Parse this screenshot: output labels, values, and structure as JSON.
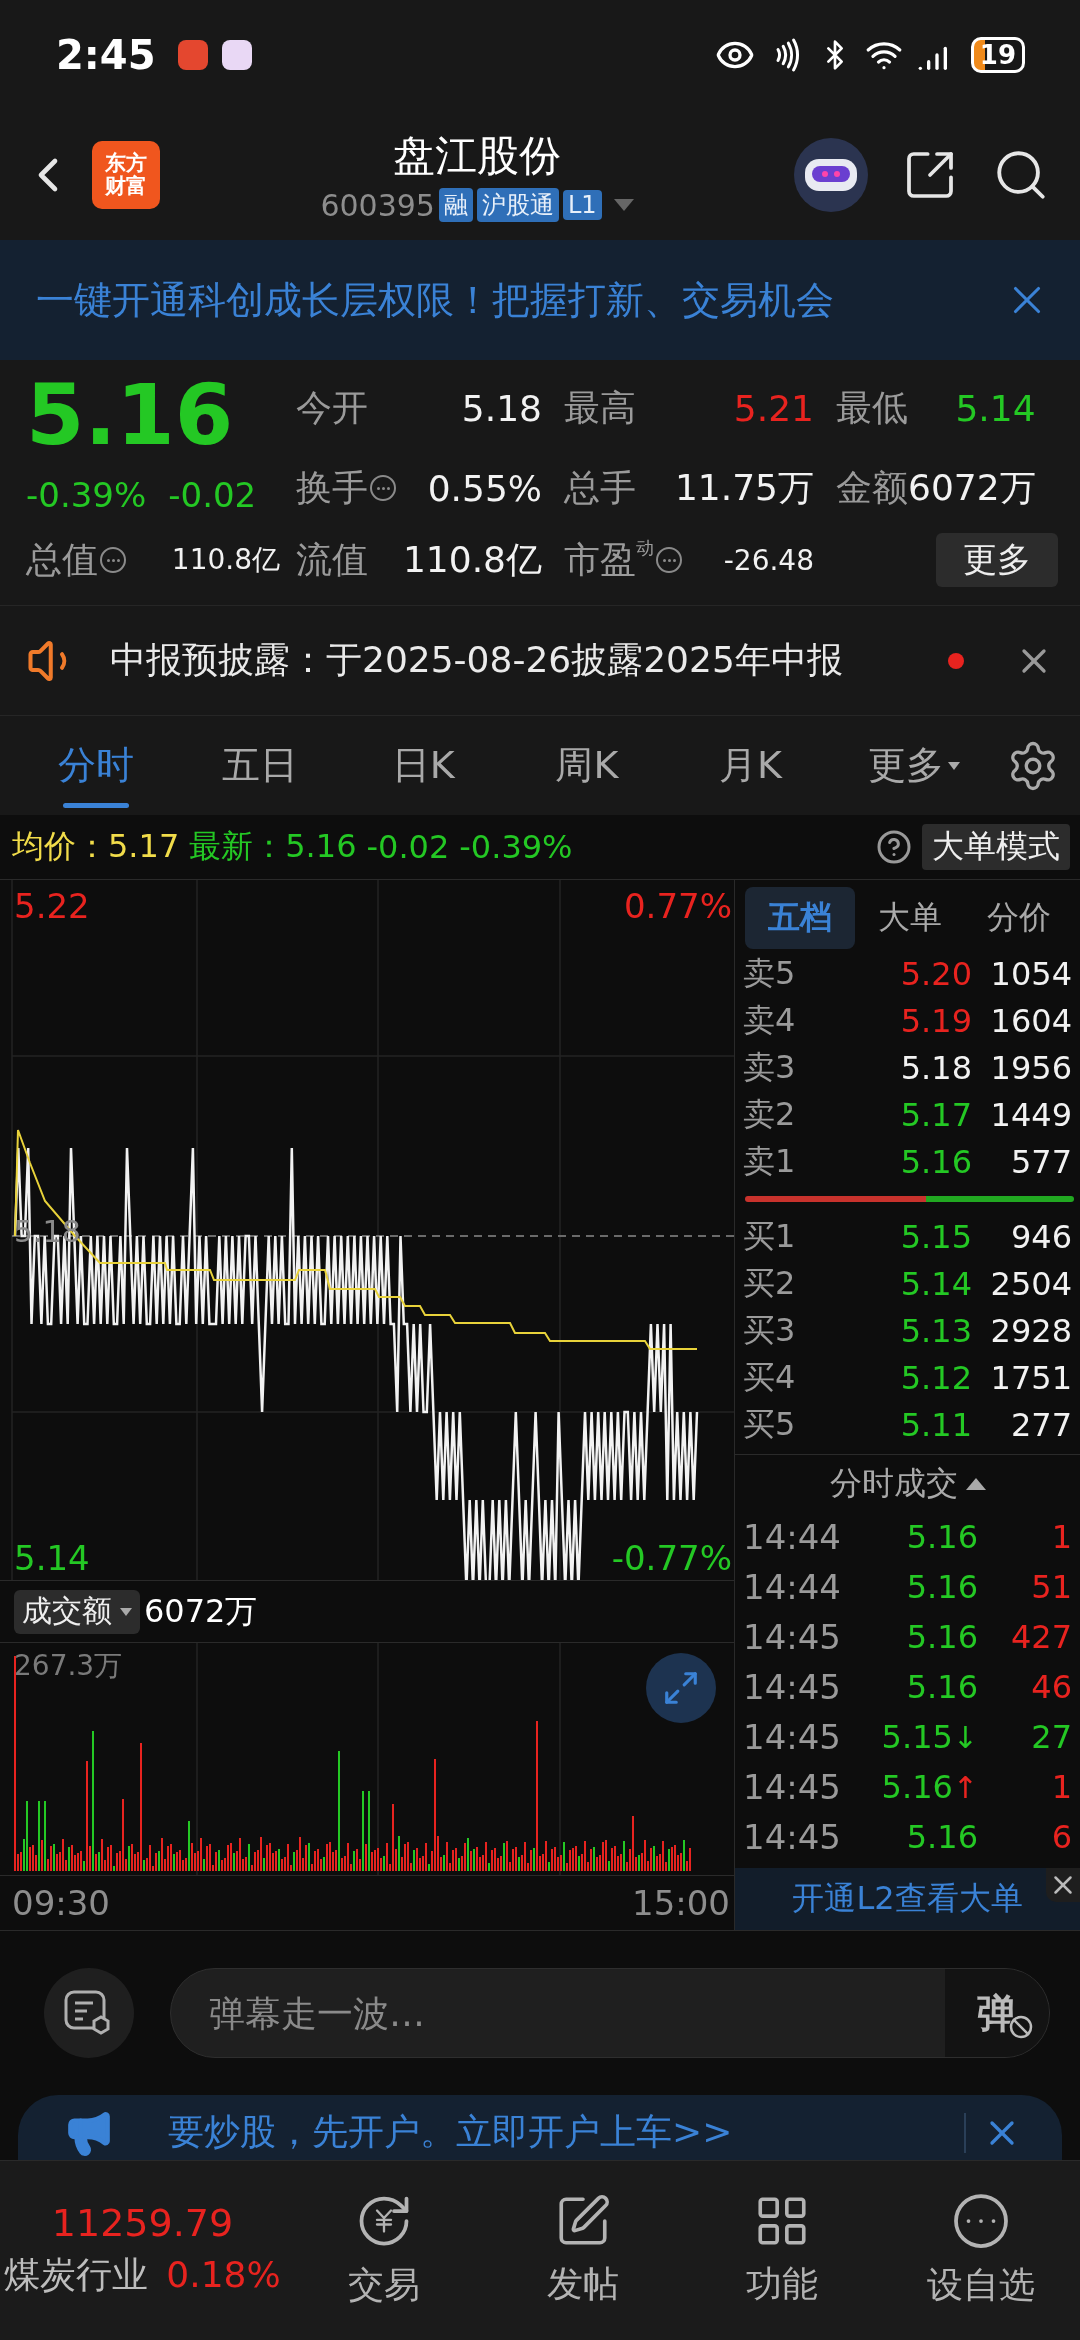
{
  "status_bar": {
    "time": "2:45",
    "battery": "19"
  },
  "header": {
    "logo": [
      "东方",
      "财富"
    ],
    "title": "盘江股份",
    "code": "600395",
    "badges": [
      "融",
      "沪股通",
      "L1"
    ]
  },
  "promo_banner": {
    "text": "一键开通科创成长层权限！把握打新、交易机会"
  },
  "quote": {
    "price": "5.16",
    "change_pct": "-0.39%",
    "change": "-0.02",
    "color": "#24c824",
    "stats": [
      {
        "label": "今开",
        "value": "5.18",
        "color": "#f2f2f2",
        "info": false,
        "kind": "normal"
      },
      {
        "label": "最高",
        "value": "5.21",
        "color": "#e8231f",
        "info": false,
        "kind": "normal"
      },
      {
        "label": "最低",
        "value": "5.14",
        "color": "#24c824",
        "info": false,
        "kind": "normal"
      },
      {
        "label": "换手",
        "value": "0.55%",
        "color": "#f2f2f2",
        "info": true,
        "kind": "normal"
      },
      {
        "label": "总手",
        "value": "11.75万",
        "color": "#f2f2f2",
        "info": false,
        "kind": "normal"
      },
      {
        "label": "金额",
        "value": "6072万",
        "color": "#f2f2f2",
        "info": false,
        "kind": "normal"
      },
      {
        "label": "流值",
        "value": "110.8亿",
        "color": "#f2f2f2",
        "info": false,
        "kind": "normal"
      },
      {
        "label": "市盈$^{动}$",
        "value": "-26.48",
        "color": "#f2f2f2",
        "info": true,
        "kind": "small"
      }
    ],
    "market_cap": {
      "label": "总值",
      "value": "110.8亿",
      "info": true
    },
    "more_button": "更多"
  },
  "notice": {
    "text": "中报预披露：于2025-08-26披露2025年中报",
    "unread": true
  },
  "chart_tabs": [
    {
      "label": "分时",
      "selected": true,
      "kind": "tab"
    },
    {
      "label": "五日",
      "selected": false,
      "kind": "tab"
    },
    {
      "label": "日K",
      "selected": false,
      "kind": "tab"
    },
    {
      "label": "周K",
      "selected": false,
      "kind": "tab"
    },
    {
      "label": "月K",
      "selected": false,
      "kind": "tab"
    },
    {
      "label": "更多",
      "selected": false,
      "kind": "menu"
    }
  ],
  "summary": {
    "avg_label": "均价：",
    "avg": "5.17",
    "latest_label": "最新：",
    "latest": "5.16",
    "change": "-0.02",
    "change_pct": "-0.39%",
    "mode_button": "大单模式"
  },
  "price_chart": {
    "high": "5.22",
    "high_pct": "0.77%",
    "prev_close": "5.18",
    "low": "5.14",
    "low_pct": "-0.77%"
  },
  "volume_chart": {
    "metric": "成交额",
    "total": "6072万",
    "max": "267.3万",
    "start": "09:30",
    "end": "15:00"
  },
  "order_book": {
    "tabs": [
      {
        "label": "五档",
        "selected": true
      },
      {
        "label": "大单",
        "selected": false
      },
      {
        "label": "分价",
        "selected": false
      }
    ],
    "asks": [
      {
        "label": "卖5",
        "price": "5.20",
        "volume": "1054",
        "color": "#e8231f"
      },
      {
        "label": "卖4",
        "price": "5.19",
        "volume": "1604",
        "color": "#e8231f"
      },
      {
        "label": "卖3",
        "price": "5.18",
        "volume": "1956",
        "color": "#f2f2f2"
      },
      {
        "label": "卖2",
        "price": "5.17",
        "volume": "1449",
        "color": "#24c824"
      },
      {
        "label": "卖1",
        "price": "5.16",
        "volume": "577",
        "color": "#24c824"
      }
    ],
    "bids": [
      {
        "label": "买1",
        "price": "5.15",
        "volume": "946",
        "color": "#24c824"
      },
      {
        "label": "买2",
        "price": "5.14",
        "volume": "2504",
        "color": "#24c824"
      },
      {
        "label": "买3",
        "price": "5.13",
        "volume": "2928",
        "color": "#24c824"
      },
      {
        "label": "买4",
        "price": "5.12",
        "volume": "1751",
        "color": "#24c824"
      },
      {
        "label": "买5",
        "price": "5.11",
        "volume": "277",
        "color": "#24c824"
      }
    ]
  },
  "trades": {
    "title": "分时成交",
    "rows": [
      {
        "time": "14:44",
        "price": "5.16",
        "volume": "1",
        "color": "#e8231f"
      },
      {
        "time": "14:44",
        "price": "5.16",
        "volume": "51",
        "color": "#e8231f"
      },
      {
        "time": "14:45",
        "price": "5.16",
        "volume": "427",
        "color": "#e8231f"
      },
      {
        "time": "14:45",
        "price": "5.16",
        "volume": "46",
        "color": "#e8231f"
      },
      {
        "time": "14:45",
        "price": "5.15",
        "volume": "27",
        "color": "#24c824",
        "arrow": "↓"
      },
      {
        "time": "14:45",
        "price": "5.16",
        "volume": "1",
        "color": "#e8231f",
        "arrow": "↑"
      },
      {
        "time": "14:45",
        "price": "5.16",
        "volume": "6",
        "color": "#e8231f"
      }
    ]
  },
  "l2_banner": {
    "text": "开通L2查看大单"
  },
  "danmaku": {
    "placeholder": "弹幕走一波…",
    "button": "弹"
  },
  "ad_banner": {
    "text": "要炒股，先开户。立即开户上车>>"
  },
  "bottom_nav": {
    "index": {
      "value": "11259.79",
      "name": "煤炭行业",
      "pct": "0.18%",
      "color": "#e8231f"
    },
    "items": [
      {
        "label": "交易",
        "kind": "trade"
      },
      {
        "label": "发帖",
        "kind": "post"
      },
      {
        "label": "功能",
        "kind": "tools"
      },
      {
        "label": "设自选",
        "kind": "watch"
      }
    ]
  }
}
